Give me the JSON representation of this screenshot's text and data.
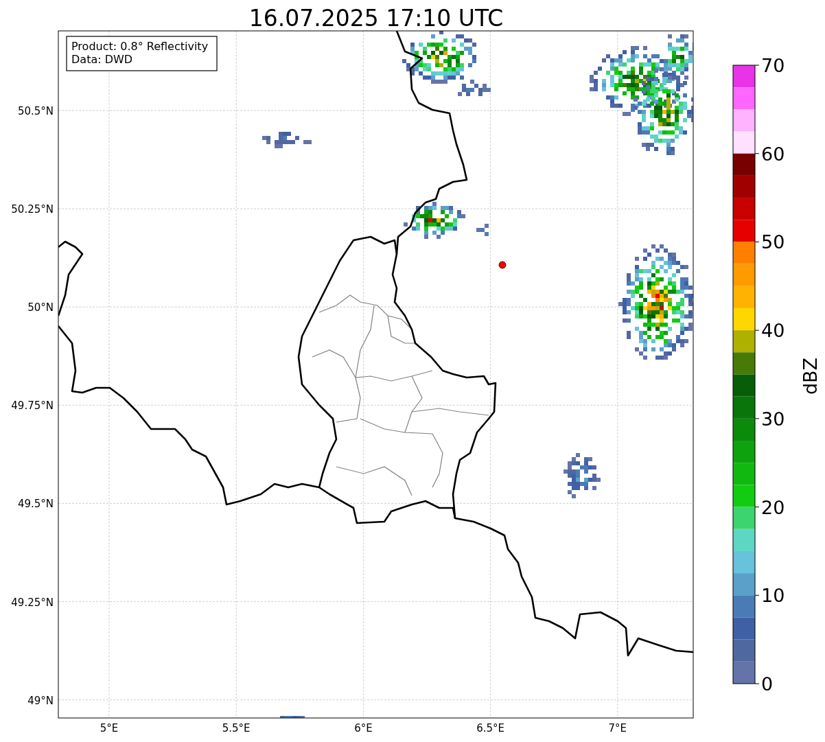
{
  "title": "16.07.2025 17:10 UTC",
  "info_box": {
    "lines": [
      "Product: 0.8° Reflectivity",
      "Data: DWD"
    ]
  },
  "map": {
    "lat_labels": [
      "50.5°N",
      "50.25°N",
      "50°N",
      "49.75°N",
      "49.5°N",
      "49.25°N",
      "49°N"
    ],
    "lon_labels": [
      "5°E",
      "5.5°E",
      "6°E",
      "6.5°E",
      "7°E"
    ]
  },
  "colorbar": {
    "label": "dBZ",
    "ticks": [
      "70",
      "60",
      "50",
      "40",
      "30",
      "20",
      "10",
      "0"
    ],
    "segments": [
      {
        "color": "#e833e8"
      },
      {
        "color": "#ff66ff"
      },
      {
        "color": "#ffb3ff"
      },
      {
        "color": "#ffe0ff"
      },
      {
        "color": "#780000"
      },
      {
        "color": "#a00000"
      },
      {
        "color": "#c80000"
      },
      {
        "color": "#e60000"
      },
      {
        "color": "#ff7f00"
      },
      {
        "color": "#ff9a00"
      },
      {
        "color": "#ffb300"
      },
      {
        "color": "#ffd700"
      },
      {
        "color": "#b0b000"
      },
      {
        "color": "#487a08"
      },
      {
        "color": "#085e08"
      },
      {
        "color": "#0a750a"
      },
      {
        "color": "#0c8a0c"
      },
      {
        "color": "#0ea30e"
      },
      {
        "color": "#10b810"
      },
      {
        "color": "#12cc12"
      },
      {
        "color": "#3cd46e"
      },
      {
        "color": "#5ed6c4"
      },
      {
        "color": "#67c2dc"
      },
      {
        "color": "#5ba0c8"
      },
      {
        "color": "#4b7bb5"
      },
      {
        "color": "#4060a5"
      },
      {
        "color": "#5068a0"
      },
      {
        "color": "#6474a8"
      }
    ]
  }
}
